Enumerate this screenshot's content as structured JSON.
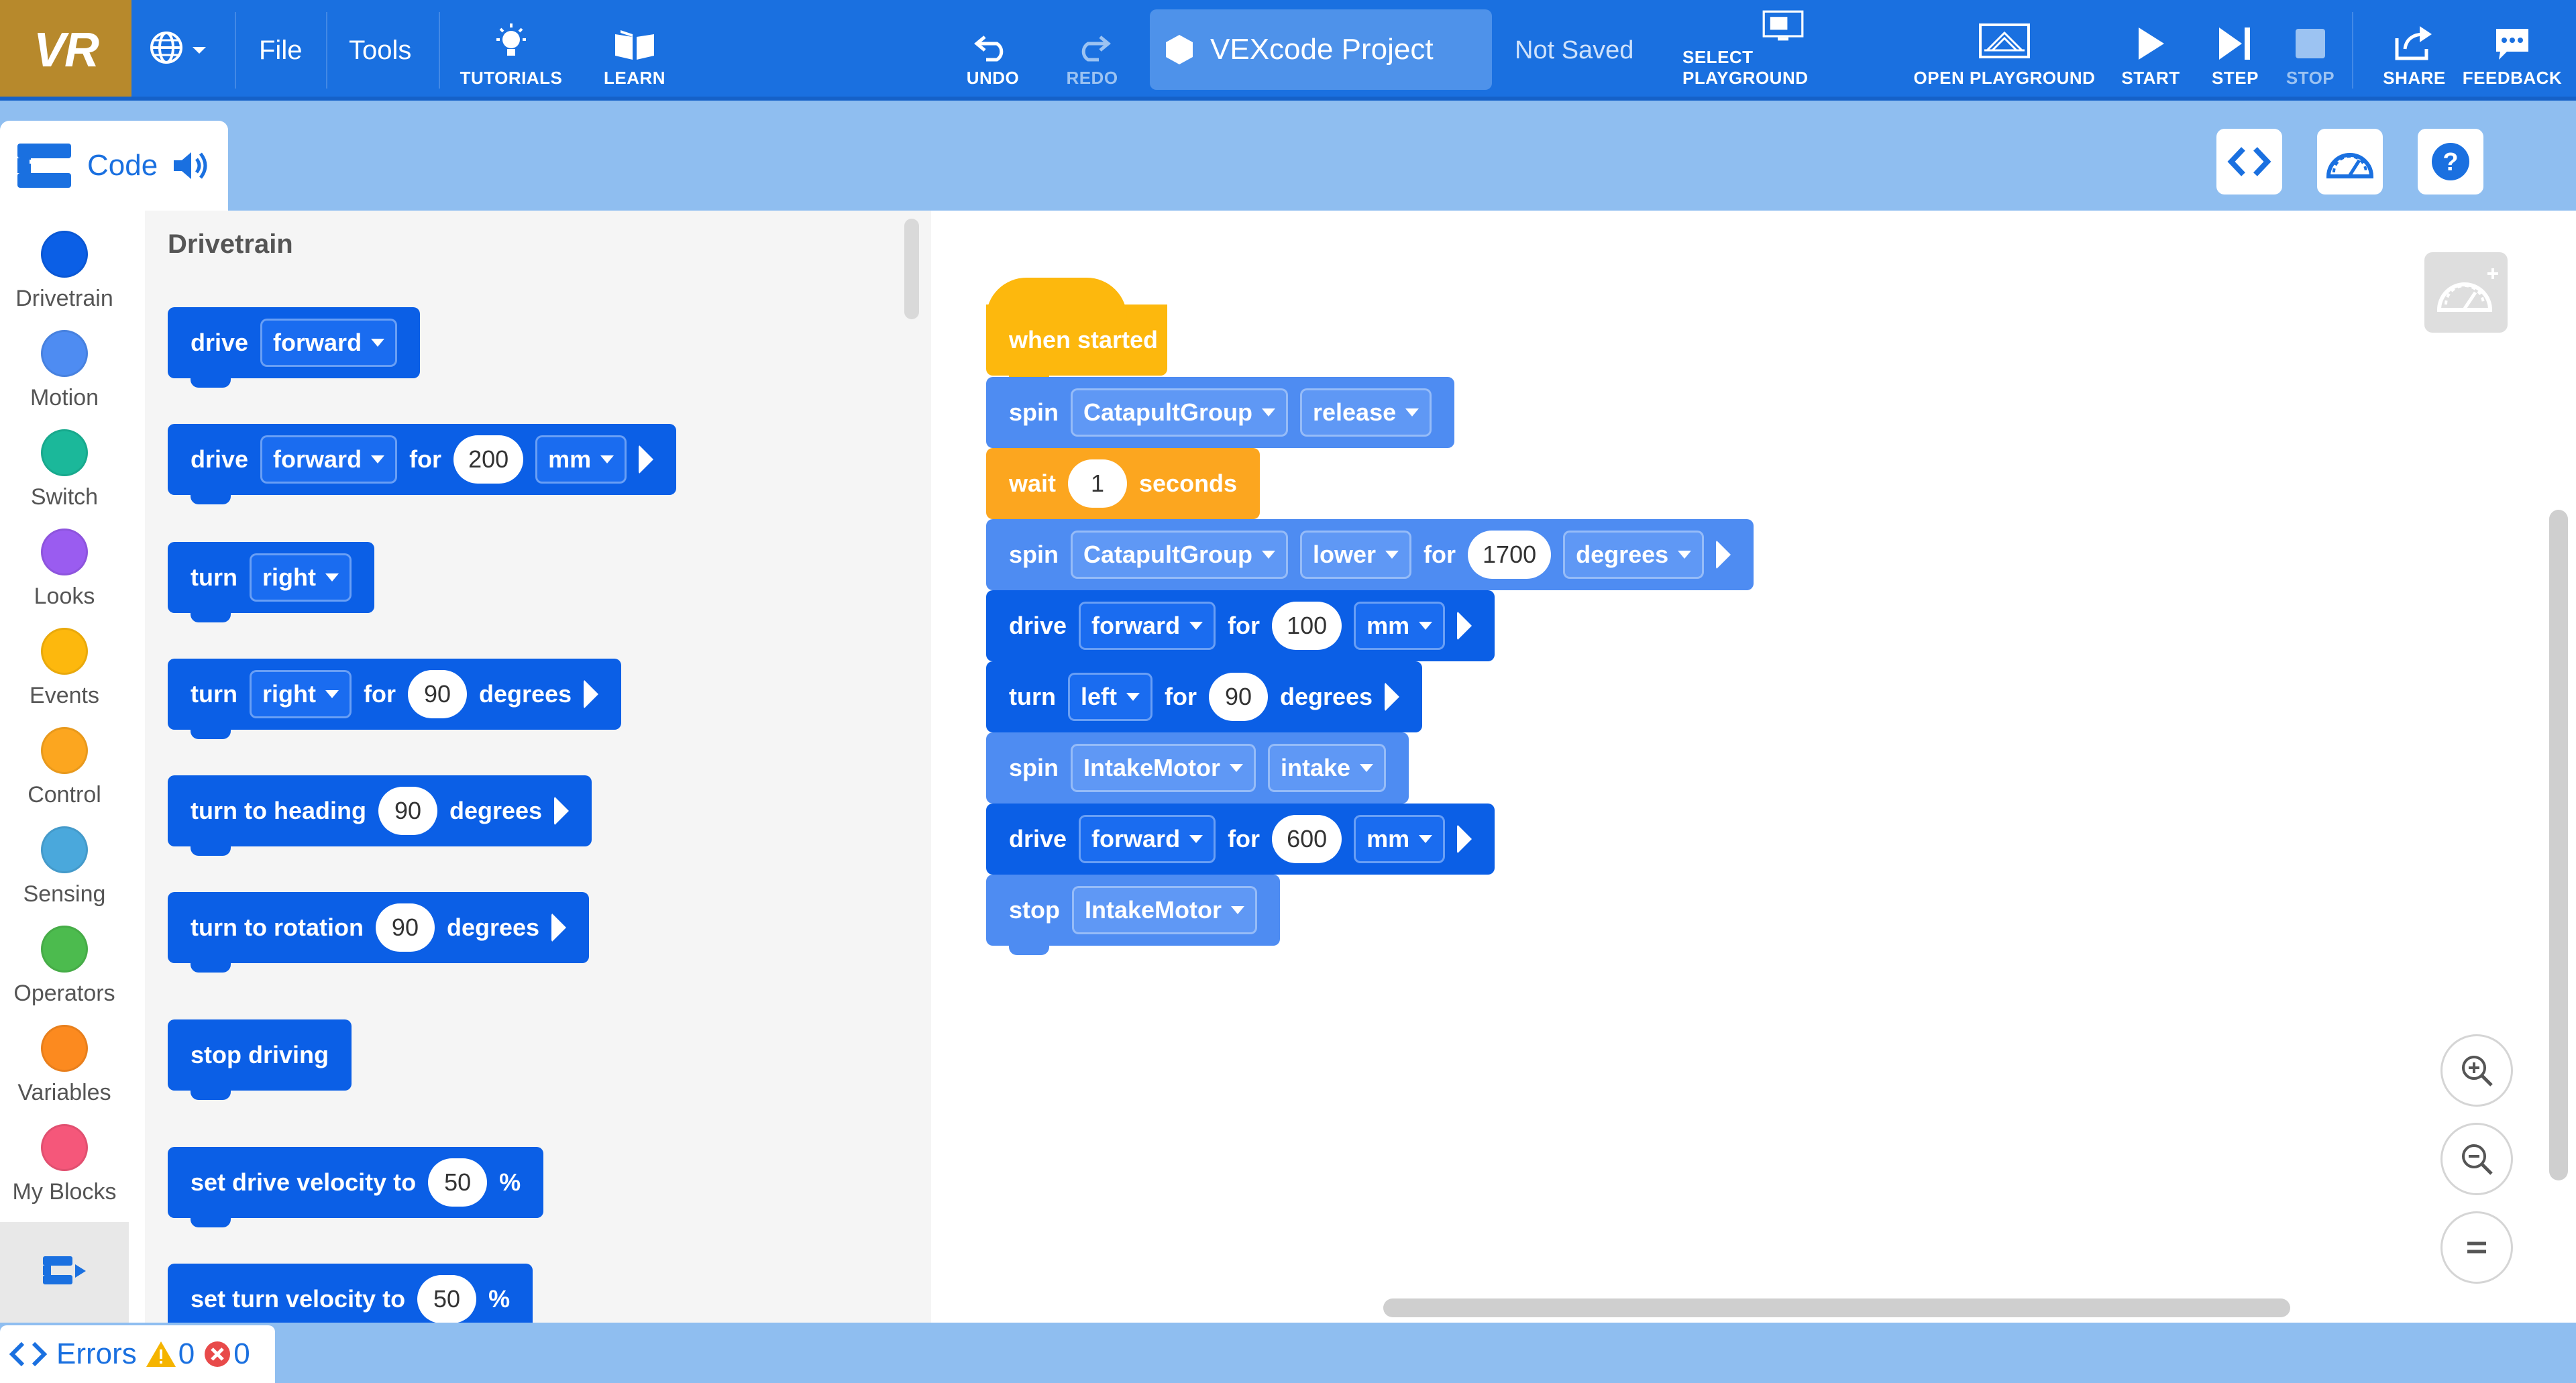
{
  "app": {
    "logo": "VR",
    "menu": {
      "file": "File",
      "tools": "Tools"
    },
    "toolbar": {
      "tutorials": "TUTORIALS",
      "learn": "LEARN",
      "undo": "UNDO",
      "redo": "REDO",
      "project_name": "VEXcode Project",
      "save_status": "Not Saved",
      "select_playground": "SELECT PLAYGROUND",
      "open_playground": "OPEN PLAYGROUND",
      "start": "START",
      "step": "STEP",
      "stop": "STOP",
      "share": "SHARE",
      "feedback": "FEEDBACK"
    }
  },
  "subbar": {
    "code_tab": "Code"
  },
  "categories": [
    {
      "label": "Drivetrain",
      "color": "#0b5fe6"
    },
    {
      "label": "Motion",
      "color": "#4e8cf2"
    },
    {
      "label": "Switch",
      "color": "#1bb89a"
    },
    {
      "label": "Looks",
      "color": "#9a5cf0"
    },
    {
      "label": "Events",
      "color": "#fdb80d"
    },
    {
      "label": "Control",
      "color": "#fca61f"
    },
    {
      "label": "Sensing",
      "color": "#4aa8dc"
    },
    {
      "label": "Operators",
      "color": "#4cbb4e"
    },
    {
      "label": "Variables",
      "color": "#fc8a1f"
    },
    {
      "label": "My Blocks",
      "color": "#f5577a"
    }
  ],
  "flyout": {
    "title": "Drivetrain",
    "blocks": [
      {
        "drive": "drive",
        "dir": "forward"
      },
      {
        "drive": "drive",
        "dir": "forward",
        "for": "for",
        "value": "200",
        "unit": "mm"
      },
      {
        "turn": "turn",
        "dir": "right"
      },
      {
        "turn": "turn",
        "dir": "right",
        "for": "for",
        "value": "90",
        "unit": "degrees"
      },
      {
        "text": "turn to heading",
        "value": "90",
        "unit": "degrees"
      },
      {
        "text": "turn to rotation",
        "value": "90",
        "unit": "degrees"
      },
      {
        "text": "stop driving"
      },
      {
        "text": "set drive velocity to",
        "value": "50",
        "unit": "%"
      },
      {
        "text": "set turn velocity to",
        "value": "50",
        "unit": "%"
      }
    ]
  },
  "workspace": {
    "program": [
      {
        "text": "when started"
      },
      {
        "verb": "spin",
        "target": "CatapultGroup",
        "mode": "release"
      },
      {
        "verb": "wait",
        "value": "1",
        "unit": "seconds"
      },
      {
        "verb": "spin",
        "target": "CatapultGroup",
        "mode": "lower",
        "for": "for",
        "value": "1700",
        "unit": "degrees"
      },
      {
        "verb": "drive",
        "dir": "forward",
        "for": "for",
        "value": "100",
        "unit": "mm"
      },
      {
        "verb": "turn",
        "dir": "left",
        "for": "for",
        "value": "90",
        "unit": "degrees"
      },
      {
        "verb": "spin",
        "target": "IntakeMotor",
        "mode": "intake"
      },
      {
        "verb": "drive",
        "dir": "forward",
        "for": "for",
        "value": "600",
        "unit": "mm"
      },
      {
        "verb": "stop",
        "target": "IntakeMotor"
      }
    ]
  },
  "errors": {
    "label": "Errors",
    "warnings": "0",
    "errors": "0"
  },
  "colors": {
    "accent": "#1a70e0",
    "logo_bg": "#b7892c",
    "subbar": "#8fbef0"
  }
}
